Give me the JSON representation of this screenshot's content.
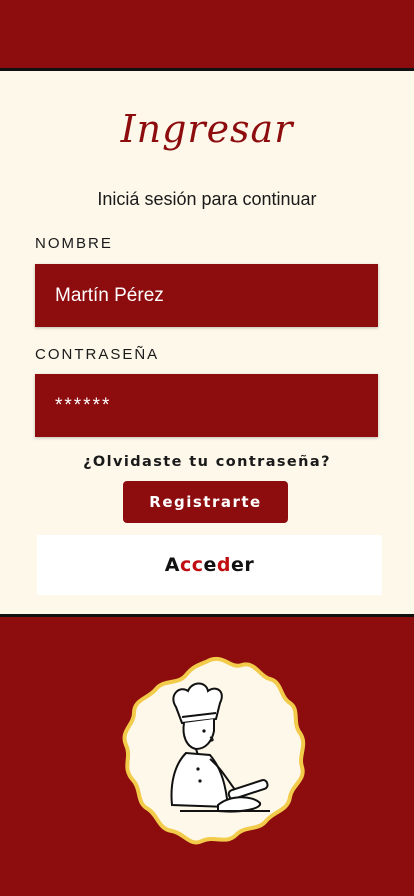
{
  "login": {
    "title": "Ingresar",
    "subtitle": "Iniciá sesión para continuar",
    "name_label": "NOMBRE",
    "name_value": "Martín Pérez",
    "password_label": "CONTRASEÑA",
    "password_value": "******",
    "forgot_label": "¿Olvidaste tu contraseña?",
    "register_label": "Registrarte",
    "access_label": {
      "part1": "A",
      "part2": "cc",
      "part3": "e",
      "part4": "d",
      "part5": "e",
      "part6": "r"
    }
  },
  "illustration": {
    "icon": "chef-rolling-dough-icon"
  },
  "colors": {
    "brand_red": "#8d0c0e",
    "cream": "#fdf8ea",
    "accent_red": "#c00d12",
    "frame_yellow": "#f2cb4a"
  }
}
